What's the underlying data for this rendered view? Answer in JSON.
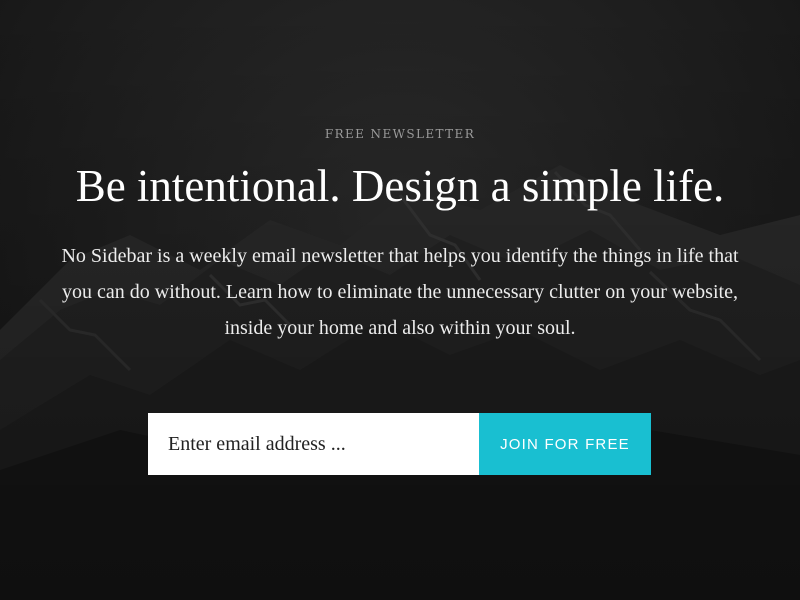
{
  "newsletter": {
    "eyebrow": "FREE NEWSLETTER",
    "headline": "Be intentional. Design a simple life.",
    "description": "No Sidebar is a weekly email newsletter that helps you identify the things in life that you can do without. Learn how to eliminate the unnecessary clutter on your website, inside your home and also within your soul."
  },
  "signup": {
    "email_placeholder": "Enter email address ...",
    "button_label": "JOIN FOR FREE",
    "button_color": "#19bfd1"
  },
  "colors": {
    "background": "#1b1b1b",
    "text": "#ffffff",
    "eyebrow": "#9a9a9a"
  }
}
